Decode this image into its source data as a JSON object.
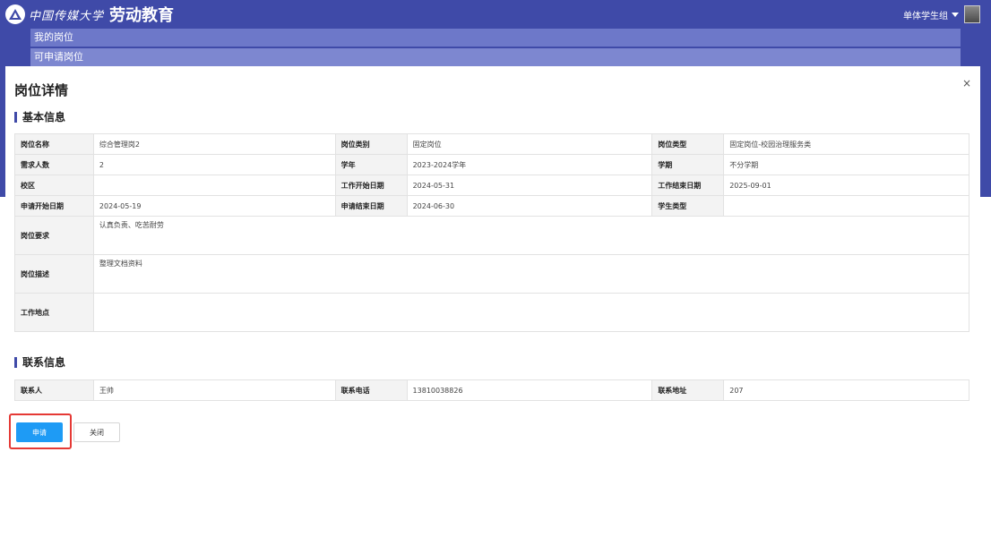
{
  "header": {
    "school_name": "中国传媒大学",
    "app_title": "劳动教育",
    "user_role": "单体学生组"
  },
  "subnav": {
    "items": [
      "我的岗位",
      "可申请岗位"
    ]
  },
  "modal": {
    "title": "岗位详情",
    "close_symbol": "×",
    "basic_section": "基本信息",
    "contact_section": "联系信息",
    "basic": {
      "post_name_label": "岗位名称",
      "post_name": "综合管理岗2",
      "post_category_label": "岗位类别",
      "post_category": "固定岗位",
      "post_type_label": "岗位类型",
      "post_type": "固定岗位-校园治理服务类",
      "headcount_label": "需求人数",
      "headcount": "2",
      "school_year_label": "学年",
      "school_year": "2023-2024学年",
      "semester_label": "学期",
      "semester": "不分学期",
      "campus_label": "校区",
      "campus": "",
      "work_start_label": "工作开始日期",
      "work_start": "2024-05-31",
      "work_end_label": "工作结束日期",
      "work_end": "2025-09-01",
      "apply_start_label": "申请开始日期",
      "apply_start": "2024-05-19",
      "apply_end_label": "申请结束日期",
      "apply_end": "2024-06-30",
      "student_type_label": "学生类型",
      "student_type": "",
      "requirements_label": "岗位要求",
      "requirements": "认真负责、吃苦耐劳",
      "description_label": "岗位描述",
      "description": "整理文档资料",
      "location_label": "工作地点",
      "location": ""
    },
    "contact": {
      "person_label": "联系人",
      "person": "王帅",
      "phone_label": "联系电话",
      "phone": "13810038826",
      "address_label": "联系地址",
      "address": "207"
    },
    "buttons": {
      "apply": "申请",
      "close": "关闭"
    }
  },
  "colors": {
    "header_bg": "#3f4aa8",
    "primary_button": "#1e9bf5",
    "highlight": "#e53935"
  },
  "icons": [
    "school-emblem-icon",
    "chevron-down-icon",
    "close-icon"
  ]
}
